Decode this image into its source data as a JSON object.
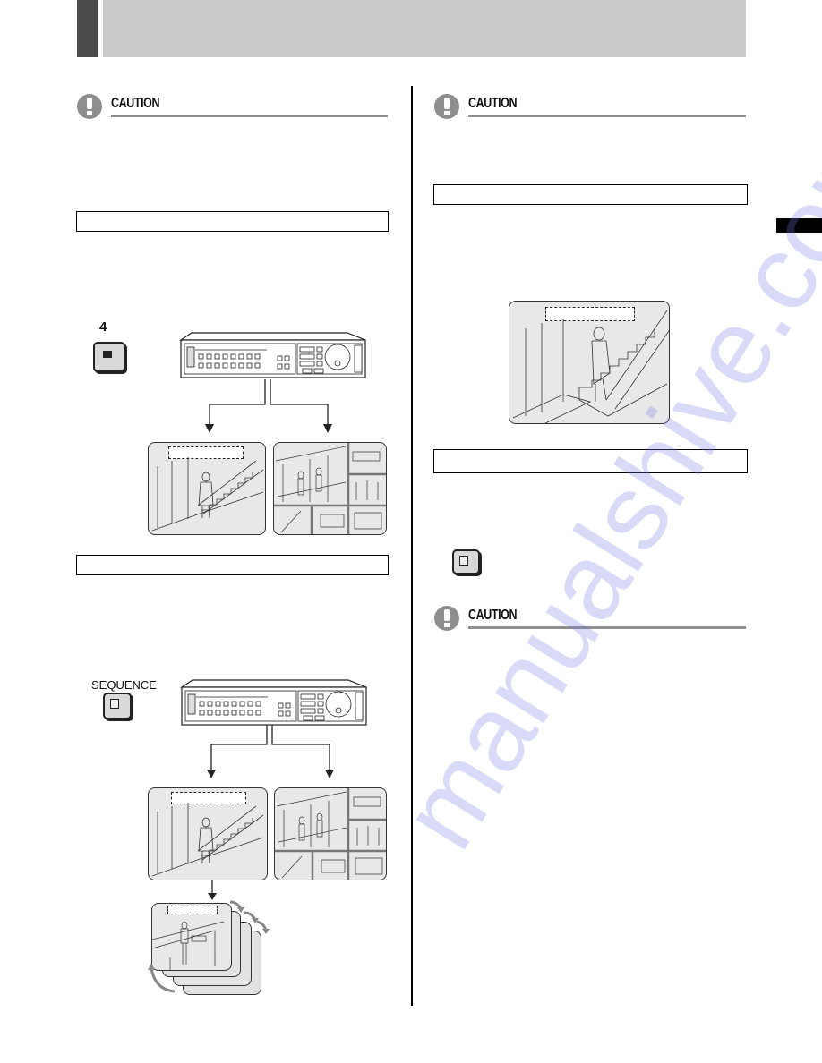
{
  "header": {
    "title": "",
    "accent_color": "#4b4b4b",
    "band_color": "#cbcbcb"
  },
  "left_column": {
    "caution_1": {
      "label": "CAUTION"
    },
    "section_1": {
      "title": ""
    },
    "key_4": {
      "label": "4",
      "icon": "key-solid-square-icon"
    },
    "section_2": {
      "title": ""
    },
    "key_sequence": {
      "label": "SEQUENCE",
      "icon": "key-hollow-square-icon"
    }
  },
  "right_column": {
    "caution_2": {
      "label": "CAUTION"
    },
    "section_3": {
      "title": ""
    },
    "section_4": {
      "title": ""
    },
    "key_blank": {
      "label": "",
      "icon": "key-hollow-square-icon"
    },
    "caution_3": {
      "label": "CAUTION"
    }
  },
  "side_tab": {
    "label": ""
  },
  "watermark": {
    "text": "manualshive.com"
  },
  "colors": {
    "caution_gray": "#8e8e8e",
    "screen_bg": "#e8e8e8",
    "watermark": "#7878e6"
  }
}
